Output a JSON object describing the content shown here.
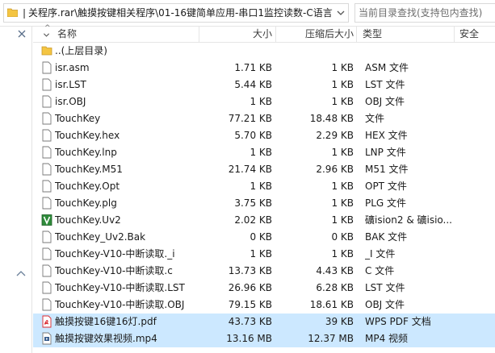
{
  "address_bar": {
    "path": "❘关程序.rar\\触摸按键相关程序\\01-16键简单应用-串口1监控读数-C语言"
  },
  "search": {
    "placeholder": "当前目录查找(支持包内查找)"
  },
  "columns": {
    "name": "名称",
    "size": "大小",
    "compressed": "压缩后大小",
    "type": "类型",
    "security": "安全"
  },
  "files": [
    {
      "name": "..(上层目录)",
      "size": "",
      "compressed": "",
      "type": "",
      "icon": "folder-icon"
    },
    {
      "name": "isr.asm",
      "size": "1.71 KB",
      "compressed": "1 KB",
      "type": "ASM 文件",
      "icon": "file-icon"
    },
    {
      "name": "isr.LST",
      "size": "5.44 KB",
      "compressed": "1 KB",
      "type": "LST 文件",
      "icon": "file-icon"
    },
    {
      "name": "isr.OBJ",
      "size": "1 KB",
      "compressed": "1 KB",
      "type": "OBJ 文件",
      "icon": "file-icon"
    },
    {
      "name": "TouchKey",
      "size": "77.21 KB",
      "compressed": "18.48 KB",
      "type": "文件",
      "icon": "file-icon"
    },
    {
      "name": "TouchKey.hex",
      "size": "5.70 KB",
      "compressed": "2.29 KB",
      "type": "HEX 文件",
      "icon": "file-icon"
    },
    {
      "name": "TouchKey.lnp",
      "size": "1 KB",
      "compressed": "1 KB",
      "type": "LNP 文件",
      "icon": "file-icon"
    },
    {
      "name": "TouchKey.M51",
      "size": "21.74 KB",
      "compressed": "2.96 KB",
      "type": "M51 文件",
      "icon": "file-icon"
    },
    {
      "name": "TouchKey.Opt",
      "size": "1 KB",
      "compressed": "1 KB",
      "type": "OPT 文件",
      "icon": "file-icon"
    },
    {
      "name": "TouchKey.plg",
      "size": "3.75 KB",
      "compressed": "1 KB",
      "type": "PLG 文件",
      "icon": "file-icon"
    },
    {
      "name": "TouchKey.Uv2",
      "size": "2.02 KB",
      "compressed": "1 KB",
      "type": "礦ision2 & 礦isio...",
      "icon": "uvision-icon"
    },
    {
      "name": "TouchKey_Uv2.Bak",
      "size": "0 KB",
      "compressed": "0 KB",
      "type": "BAK 文件",
      "icon": "file-icon"
    },
    {
      "name": "TouchKey-V10-中断读取._i",
      "size": "1 KB",
      "compressed": "1 KB",
      "type": "_I 文件",
      "icon": "file-icon"
    },
    {
      "name": "TouchKey-V10-中断读取.c",
      "size": "13.73 KB",
      "compressed": "4.43 KB",
      "type": "C 文件",
      "icon": "file-icon"
    },
    {
      "name": "TouchKey-V10-中断读取.LST",
      "size": "26.96 KB",
      "compressed": "6.28 KB",
      "type": "LST 文件",
      "icon": "file-icon"
    },
    {
      "name": "TouchKey-V10-中断读取.OBJ",
      "size": "79.15 KB",
      "compressed": "18.61 KB",
      "type": "OBJ 文件",
      "icon": "file-icon"
    },
    {
      "name": "触摸按键16键16灯.pdf",
      "size": "43.73 KB",
      "compressed": "39 KB",
      "type": "WPS PDF 文档",
      "icon": "pdf-icon",
      "selected": true
    },
    {
      "name": "触摸按键效果视频.mp4",
      "size": "13.16 MB",
      "compressed": "12.37 MB",
      "type": "MP4 视频",
      "icon": "video-icon",
      "selected": true
    }
  ],
  "colors": {
    "selection": "#cce8ff",
    "folder": "#f4c542",
    "pdf_red": "#d9282f",
    "uvision_green": "#2e8b3a"
  }
}
